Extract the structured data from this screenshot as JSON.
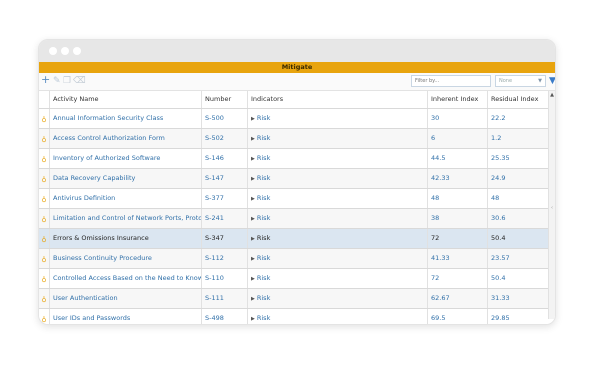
{
  "window": {
    "title": "Mitigate"
  },
  "toolbar": {
    "add_icon": "+",
    "edit_icon": "✎",
    "copy_icon": "❐",
    "delete_icon": "⌫",
    "filter_placeholder": "Filter by...",
    "select_value": "None",
    "filter_icon": "▼"
  },
  "table": {
    "columns": [
      "Activity Name",
      "Number",
      "Indicators",
      "Inherent Index",
      "Residual Index"
    ],
    "rows": [
      {
        "name": "Annual Information Security Class",
        "number": "S-500",
        "indicator": "Risk",
        "inherent": "30",
        "residual": "22.2"
      },
      {
        "name": "Access Control Authorization Form",
        "number": "S-502",
        "indicator": "Risk",
        "inherent": "6",
        "residual": "1.2"
      },
      {
        "name": "Inventory of Authorized Software",
        "number": "S-146",
        "indicator": "Risk",
        "inherent": "44.5",
        "residual": "25.35"
      },
      {
        "name": "Data Recovery Capability",
        "number": "S-147",
        "indicator": "Risk",
        "inherent": "42.33",
        "residual": "24.9"
      },
      {
        "name": "Antivirus Definition",
        "number": "S-377",
        "indicator": "Risk",
        "inherent": "48",
        "residual": "48"
      },
      {
        "name": "Limitation and Control of Network Ports, Proto",
        "number": "S-241",
        "indicator": "Risk",
        "inherent": "38",
        "residual": "30.6"
      },
      {
        "name": "Errors & Omissions Insurance",
        "number": "S-347",
        "indicator": "Risk",
        "inherent": "72",
        "residual": "50.4"
      },
      {
        "name": "Business Continuity Procedure",
        "number": "S-112",
        "indicator": "Risk",
        "inherent": "41.33",
        "residual": "23.57"
      },
      {
        "name": "Controlled Access Based on the Need to Know",
        "number": "S-110",
        "indicator": "Risk",
        "inherent": "72",
        "residual": "50.4"
      },
      {
        "name": "User Authentication",
        "number": "S-111",
        "indicator": "Risk",
        "inherent": "62.67",
        "residual": "31.33"
      },
      {
        "name": "User IDs and Passwords",
        "number": "S-498",
        "indicator": "Risk",
        "inherent": "69.5",
        "residual": "29.85"
      }
    ],
    "selected_index": 6
  },
  "colors": {
    "accent": "#e8a40e",
    "link": "#2f6fa8",
    "selected_row": "#dbe6f1"
  }
}
